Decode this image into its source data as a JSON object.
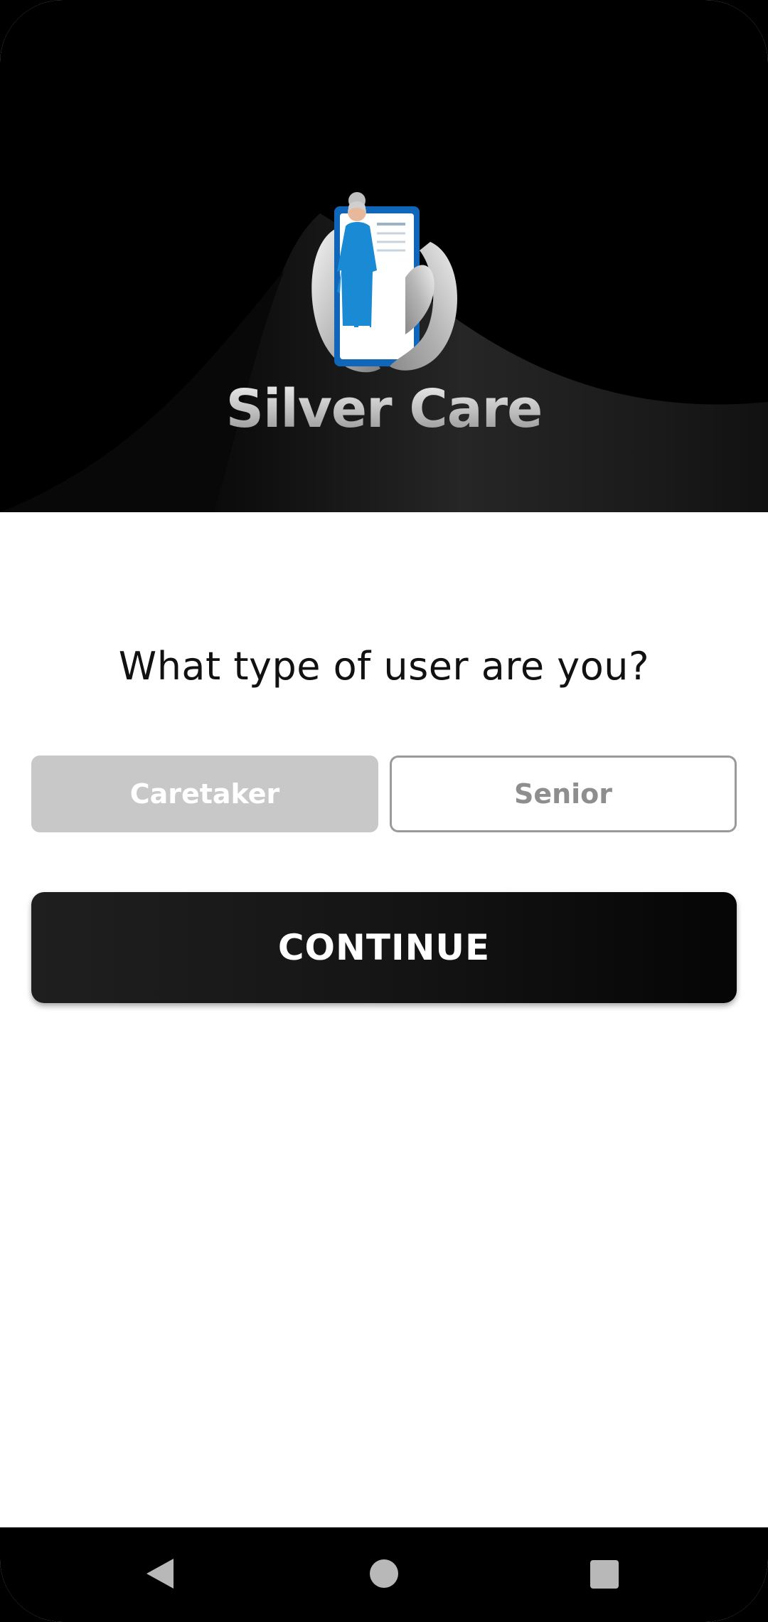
{
  "app": {
    "name": "Silver Care"
  },
  "prompt": {
    "question": "What type of user are you?"
  },
  "roles": [
    {
      "label": "Caretaker",
      "selected": false
    },
    {
      "label": "Senior",
      "selected": false
    }
  ],
  "actions": {
    "continue_label": "CONTINUE"
  },
  "nav": {
    "back_icon": "back-triangle-icon",
    "home_icon": "home-circle-icon",
    "recents_icon": "recents-square-icon"
  },
  "colors": {
    "header_bg": "#000000",
    "primary_button": "#151515",
    "caretaker_bg": "#c8c8c8",
    "senior_border": "#9a9a9a",
    "figure_dress": "#1a8ad4"
  }
}
